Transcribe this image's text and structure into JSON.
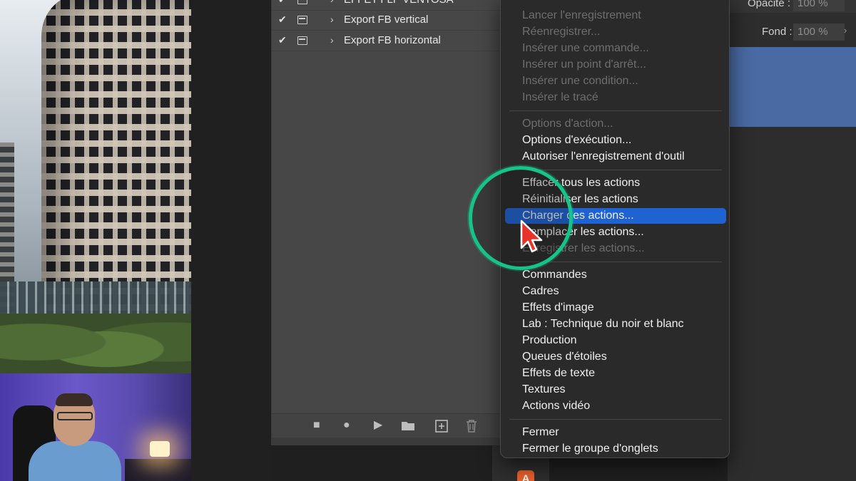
{
  "actions_panel": {
    "partial_top_label": "EFFET FLF VENTOSA",
    "rows": [
      {
        "checked": "✔",
        "label": "Export FB vertical"
      },
      {
        "checked": "✔",
        "label": "Export FB horizontal"
      }
    ],
    "footer_icons": [
      "stop-icon",
      "record-icon",
      "play-icon",
      "folder-icon",
      "new-action-icon",
      "trash-icon"
    ]
  },
  "layers_panel": {
    "opacity_label": "Opacité :",
    "opacity_value": "100 %",
    "fill_label": "Fond :",
    "fill_value": "100 %"
  },
  "context_menu": {
    "sections": [
      [
        {
          "label": "Lancer l'enregistrement",
          "enabled": false
        },
        {
          "label": "Réenregistrer...",
          "enabled": false
        },
        {
          "label": "Insérer une commande...",
          "enabled": false
        },
        {
          "label": "Insérer un point d'arrêt...",
          "enabled": false
        },
        {
          "label": "Insérer une condition...",
          "enabled": false
        },
        {
          "label": "Insérer le tracé",
          "enabled": false
        }
      ],
      [
        {
          "label": "Options d'action...",
          "enabled": false
        },
        {
          "label": "Options d'exécution...",
          "enabled": true
        },
        {
          "label": "Autoriser l'enregistrement d'outil",
          "enabled": true
        }
      ],
      [
        {
          "label": "Effacer tous les actions",
          "enabled": true
        },
        {
          "label": "Réinitialiser les actions",
          "enabled": true
        },
        {
          "label": "Charger des actions...",
          "enabled": true,
          "highlighted": true
        },
        {
          "label": "Remplacer les actions...",
          "enabled": true
        },
        {
          "label": "Enregistrer les actions...",
          "enabled": false
        }
      ],
      [
        {
          "label": "Commandes",
          "enabled": true
        },
        {
          "label": "Cadres",
          "enabled": true
        },
        {
          "label": "Effets d'image",
          "enabled": true
        },
        {
          "label": "Lab : Technique du noir et blanc",
          "enabled": true
        },
        {
          "label": "Production",
          "enabled": true
        },
        {
          "label": "Queues d'étoiles",
          "enabled": true
        },
        {
          "label": "Effets de texte",
          "enabled": true
        },
        {
          "label": "Textures",
          "enabled": true
        },
        {
          "label": "Actions vidéo",
          "enabled": true
        }
      ],
      [
        {
          "label": "Fermer",
          "enabled": true
        },
        {
          "label": "Fermer le groupe d'onglets",
          "enabled": true
        }
      ]
    ]
  },
  "colors": {
    "highlight": "#1f63d3",
    "annotation_ring": "#16c48a",
    "cursor": "#e8332a"
  },
  "dock": {
    "app_icon": "A"
  }
}
